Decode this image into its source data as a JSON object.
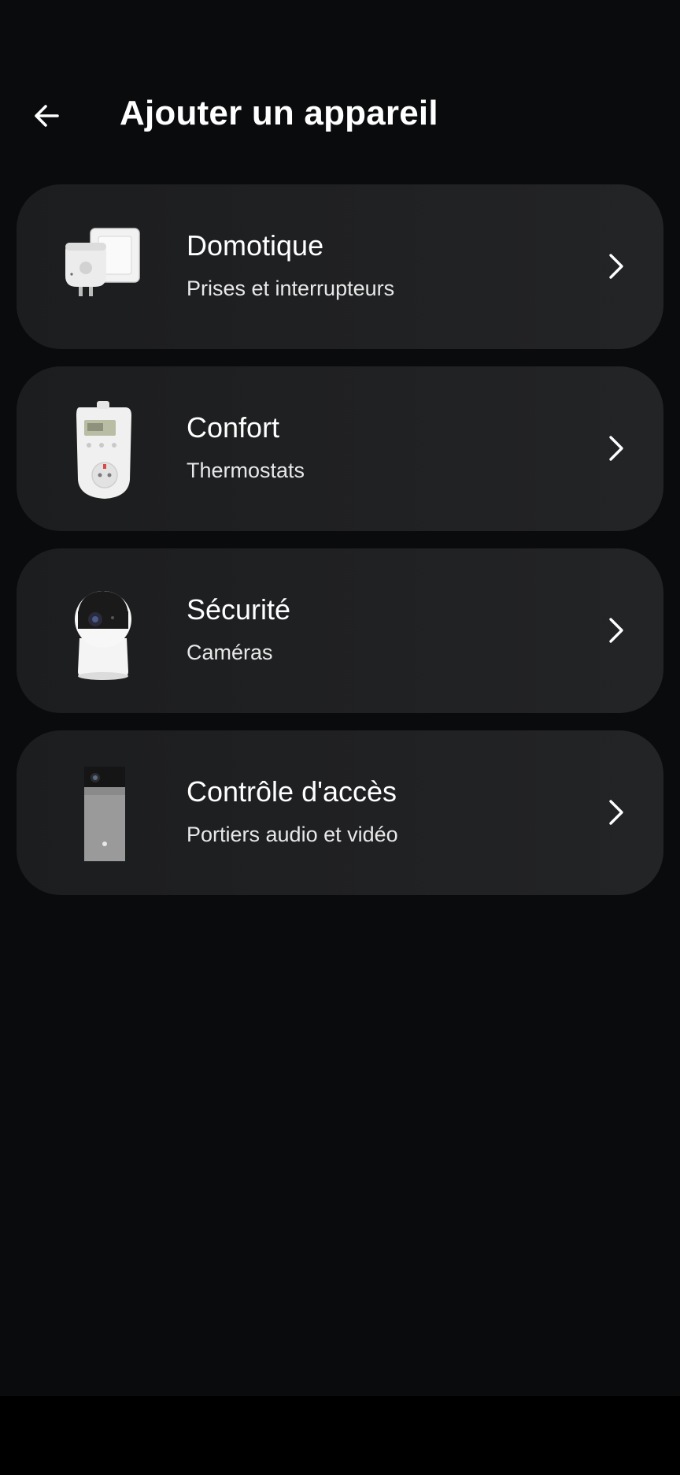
{
  "header": {
    "title": "Ajouter un appareil",
    "back_icon": "arrow-left-icon"
  },
  "categories": [
    {
      "title": "Domotique",
      "subtitle": "Prises et interrupteurs",
      "image": "smart-plug-and-switch-image"
    },
    {
      "title": "Confort",
      "subtitle": "Thermostats",
      "image": "plug-thermostat-image"
    },
    {
      "title": "Sécurité",
      "subtitle": "Caméras",
      "image": "indoor-camera-image"
    },
    {
      "title": "Contrôle d'accès",
      "subtitle": "Portiers audio et vidéo",
      "image": "video-doorbell-image"
    }
  ],
  "colors": {
    "background": "#0a0b0d",
    "card": "#1f2022",
    "text": "#ffffff"
  }
}
